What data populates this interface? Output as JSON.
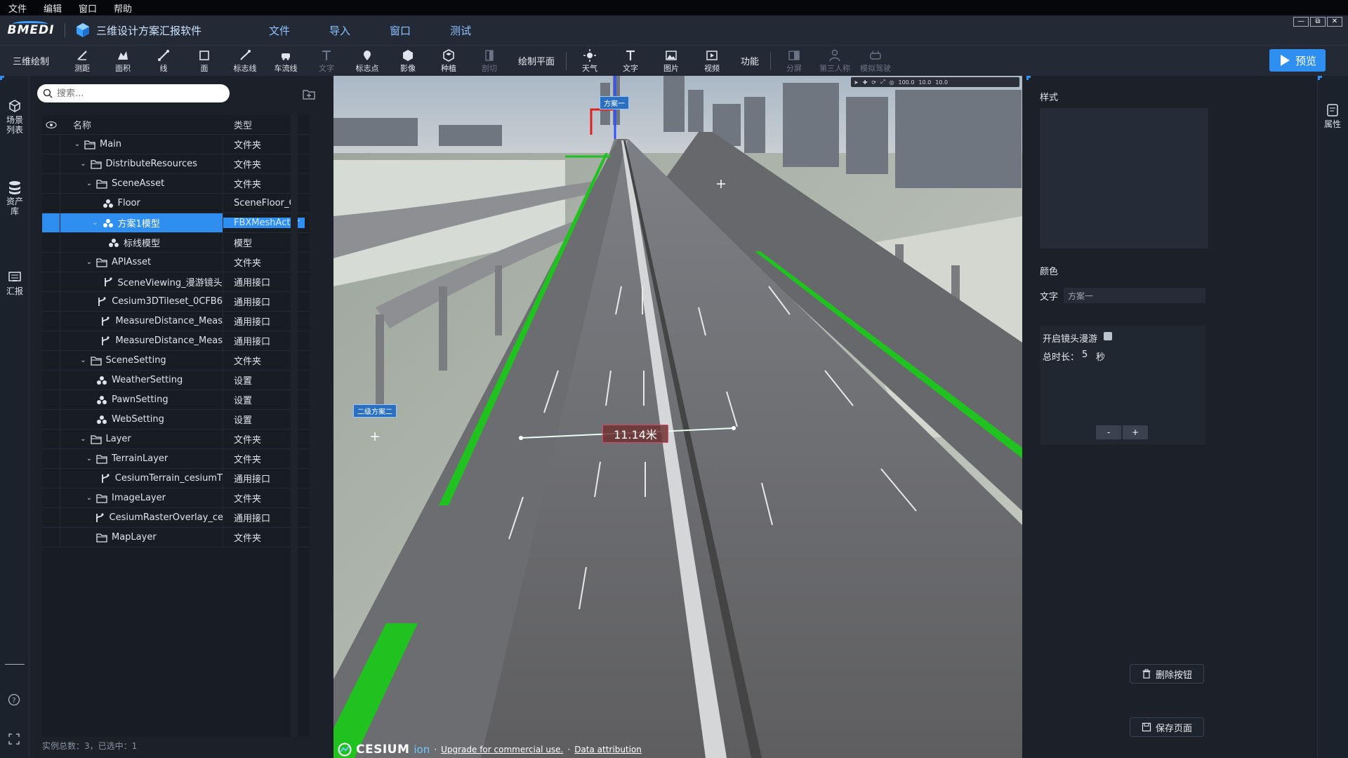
{
  "menubar": {
    "items": [
      "文件",
      "编辑",
      "窗口",
      "帮助"
    ]
  },
  "titlebar": {
    "logo": "BMEDI",
    "app_title": "三维设计方案汇报软件",
    "nav": [
      "文件",
      "导入",
      "窗口",
      "测试"
    ],
    "window_controls": [
      "minimize-icon",
      "restore-icon",
      "close-icon"
    ]
  },
  "toolbar": {
    "group_label": "三维绘制",
    "tools_a": [
      {
        "label": "测距",
        "icon": "ruler-icon",
        "dim": false
      },
      {
        "label": "面积",
        "icon": "area-icon",
        "dim": false
      },
      {
        "label": "线",
        "icon": "line-icon",
        "dim": false
      },
      {
        "label": "面",
        "icon": "polygon-icon",
        "dim": false
      },
      {
        "label": "标志线",
        "icon": "marker-line-icon",
        "dim": false
      },
      {
        "label": "车流线",
        "icon": "car-flow-icon",
        "dim": false
      },
      {
        "label": "文字",
        "icon": "text-icon",
        "dim": true
      },
      {
        "label": "标志点",
        "icon": "pin-icon",
        "dim": false
      },
      {
        "label": "影像",
        "icon": "imagery-icon",
        "dim": false
      },
      {
        "label": "种植",
        "icon": "plant-icon",
        "dim": false
      },
      {
        "label": "剖切",
        "icon": "section-icon",
        "dim": true
      }
    ],
    "draw_plane": "绘制平面",
    "tools_b": [
      {
        "label": "天气",
        "icon": "weather-icon",
        "dim": false
      },
      {
        "label": "文字",
        "icon": "text-icon",
        "dim": false
      },
      {
        "label": "图片",
        "icon": "image-icon",
        "dim": false
      },
      {
        "label": "视频",
        "icon": "video-icon",
        "dim": false
      }
    ],
    "function_label": "功能",
    "tools_c": [
      {
        "label": "分屏",
        "icon": "split-screen-icon",
        "dim": true
      },
      {
        "label": "第三人称",
        "icon": "person-icon",
        "dim": true
      },
      {
        "label": "模拟驾驶",
        "icon": "driving-icon",
        "dim": true
      }
    ],
    "preview_label": "预览"
  },
  "leftrail": {
    "items": [
      {
        "label": "场景列表",
        "icon": "scene-list-icon"
      },
      {
        "label": "资产库",
        "icon": "asset-library-icon"
      },
      {
        "label": "汇报",
        "icon": "report-icon"
      }
    ]
  },
  "outliner": {
    "search_placeholder": "搜索...",
    "col_name": "名称",
    "col_type": "类型",
    "rows": [
      {
        "name": "Main",
        "type": "文件夹",
        "depth": 0,
        "caret": true,
        "icon": "folder",
        "selected": false
      },
      {
        "name": "DistributeResources",
        "type": "文件夹",
        "depth": 1,
        "caret": true,
        "icon": "folder",
        "selected": false
      },
      {
        "name": "SceneAsset",
        "type": "文件夹",
        "depth": 2,
        "caret": true,
        "icon": "folder",
        "selected": false
      },
      {
        "name": "Floor",
        "type": "SceneFloor_C",
        "depth": 3,
        "caret": false,
        "icon": "actor",
        "selected": false
      },
      {
        "name": "方案1模型",
        "type": "FBXMeshActor",
        "depth": 3,
        "caret": true,
        "icon": "actor",
        "selected": true
      },
      {
        "name": "标线模型",
        "type": "模型",
        "depth": 4,
        "caret": false,
        "icon": "actor",
        "selected": false
      },
      {
        "name": "APIAsset",
        "type": "文件夹",
        "depth": 2,
        "caret": true,
        "icon": "folder",
        "selected": false
      },
      {
        "name": "SceneViewing_漫游镜头",
        "type": "通用接口",
        "depth": 3,
        "caret": false,
        "icon": "api",
        "selected": false
      },
      {
        "name": "Cesium3DTileset_0CFB6",
        "type": "通用接口",
        "depth": 3,
        "caret": false,
        "icon": "api",
        "selected": false
      },
      {
        "name": "MeasureDistance_Meas",
        "type": "通用接口",
        "depth": 3,
        "caret": false,
        "icon": "api",
        "selected": false
      },
      {
        "name": "MeasureDistance_Meas",
        "type": "通用接口",
        "depth": 3,
        "caret": false,
        "icon": "api",
        "selected": false
      },
      {
        "name": "SceneSetting",
        "type": "文件夹",
        "depth": 1,
        "caret": true,
        "icon": "folder",
        "selected": false
      },
      {
        "name": "WeatherSetting",
        "type": "设置",
        "depth": 2,
        "caret": false,
        "icon": "actor",
        "selected": false
      },
      {
        "name": "PawnSetting",
        "type": "设置",
        "depth": 2,
        "caret": false,
        "icon": "actor",
        "selected": false
      },
      {
        "name": "WebSetting",
        "type": "设置",
        "depth": 2,
        "caret": false,
        "icon": "actor",
        "selected": false
      },
      {
        "name": "Layer",
        "type": "文件夹",
        "depth": 1,
        "caret": true,
        "icon": "folder",
        "selected": false
      },
      {
        "name": "TerrainLayer",
        "type": "文件夹",
        "depth": 2,
        "caret": true,
        "icon": "folder",
        "selected": false
      },
      {
        "name": "CesiumTerrain_cesiumT",
        "type": "通用接口",
        "depth": 3,
        "caret": false,
        "icon": "api",
        "selected": false
      },
      {
        "name": "ImageLayer",
        "type": "文件夹",
        "depth": 2,
        "caret": true,
        "icon": "folder",
        "selected": false
      },
      {
        "name": "CesiumRasterOverlay_ce",
        "type": "通用接口",
        "depth": 3,
        "caret": false,
        "icon": "api",
        "selected": false
      },
      {
        "name": "MapLayer",
        "type": "文件夹",
        "depth": 2,
        "caret": false,
        "icon": "folder",
        "selected": false
      }
    ],
    "status": "实例总数：3，已选中：1"
  },
  "viewport": {
    "toolbar_values": [
      "100.0",
      "10.0",
      "10.0"
    ],
    "label_a": "方案一",
    "label_b": "二级方案二",
    "measure": "11.14米",
    "credit_brand": "CESIUM",
    "credit_ion": "ion",
    "credit_upgrade": "Upgrade for commercial use.",
    "credit_attribution": "Data attribution"
  },
  "props": {
    "style_label": "样式",
    "color_label": "颜色",
    "text_label": "文字",
    "text_value": "方案一",
    "camera_toggle_label": "开启镜头漫游",
    "duration_label": "总时长：",
    "duration_value": "5",
    "duration_unit": "秒",
    "minus": "-",
    "plus": "+",
    "delete_button": "删除按钮",
    "save_button": "保存页面"
  },
  "rightrail": {
    "label": "属性",
    "icon": "properties-icon"
  },
  "colors": {
    "accent": "#2f8ff0",
    "bg": "#1b2029",
    "green_strip": "#1fc21f"
  }
}
